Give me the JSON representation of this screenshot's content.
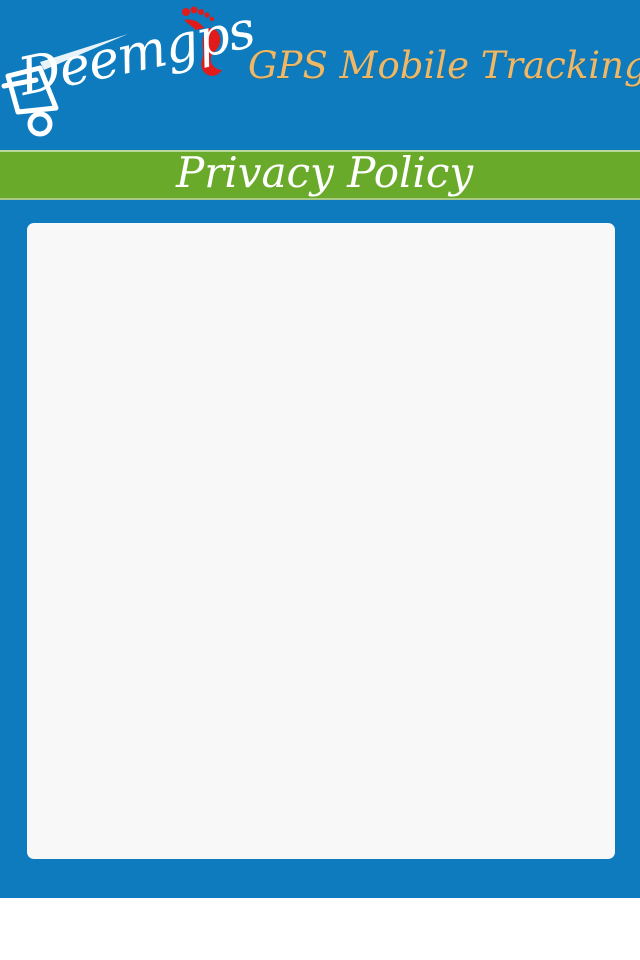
{
  "header": {
    "logo_text": "Deemgps",
    "app_title": "GPS Mobile Tracking"
  },
  "title_bar": {
    "title": "Privacy Policy"
  },
  "colors": {
    "background": "#0d7bbd",
    "title_bar": "#6aaa2a",
    "app_title": "#f0b865",
    "panel": "#f8f8f8",
    "logo_accent": "#e11a1a"
  }
}
